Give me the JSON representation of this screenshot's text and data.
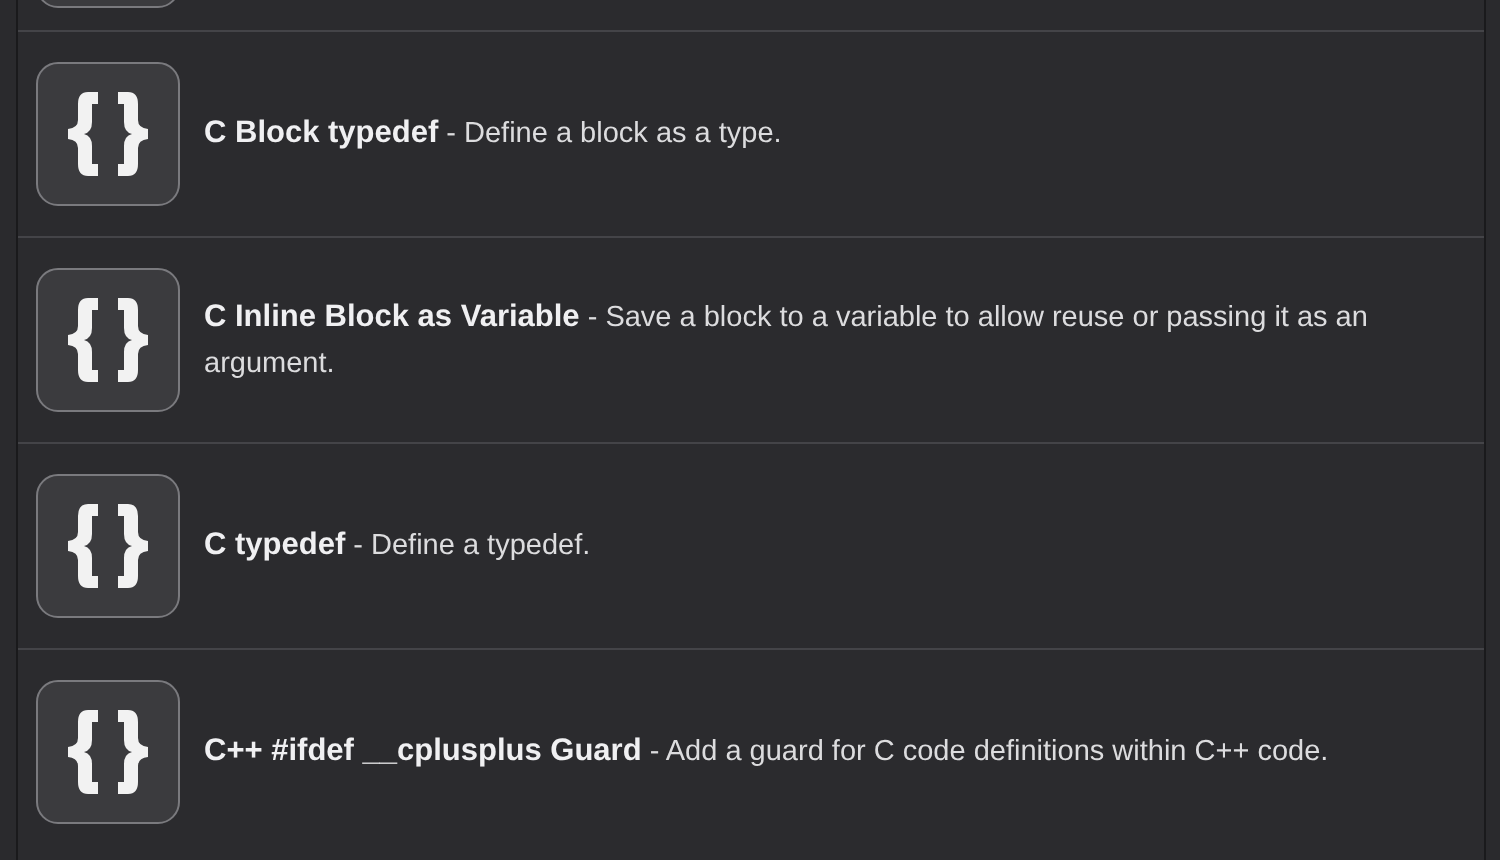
{
  "snippets": [
    {
      "text": "**C Block typedef** - Define a block as a type."
    },
    {
      "text": "**C Inline Block as Variable** - Save a block to a variable to allow reuse or passing it as an argument."
    },
    {
      "text": "**C typedef** - Define a typedef."
    },
    {
      "text": "**C++ #ifdef __cplusplus Guard** - Add a guard for C code definitions within C++ code."
    }
  ]
}
